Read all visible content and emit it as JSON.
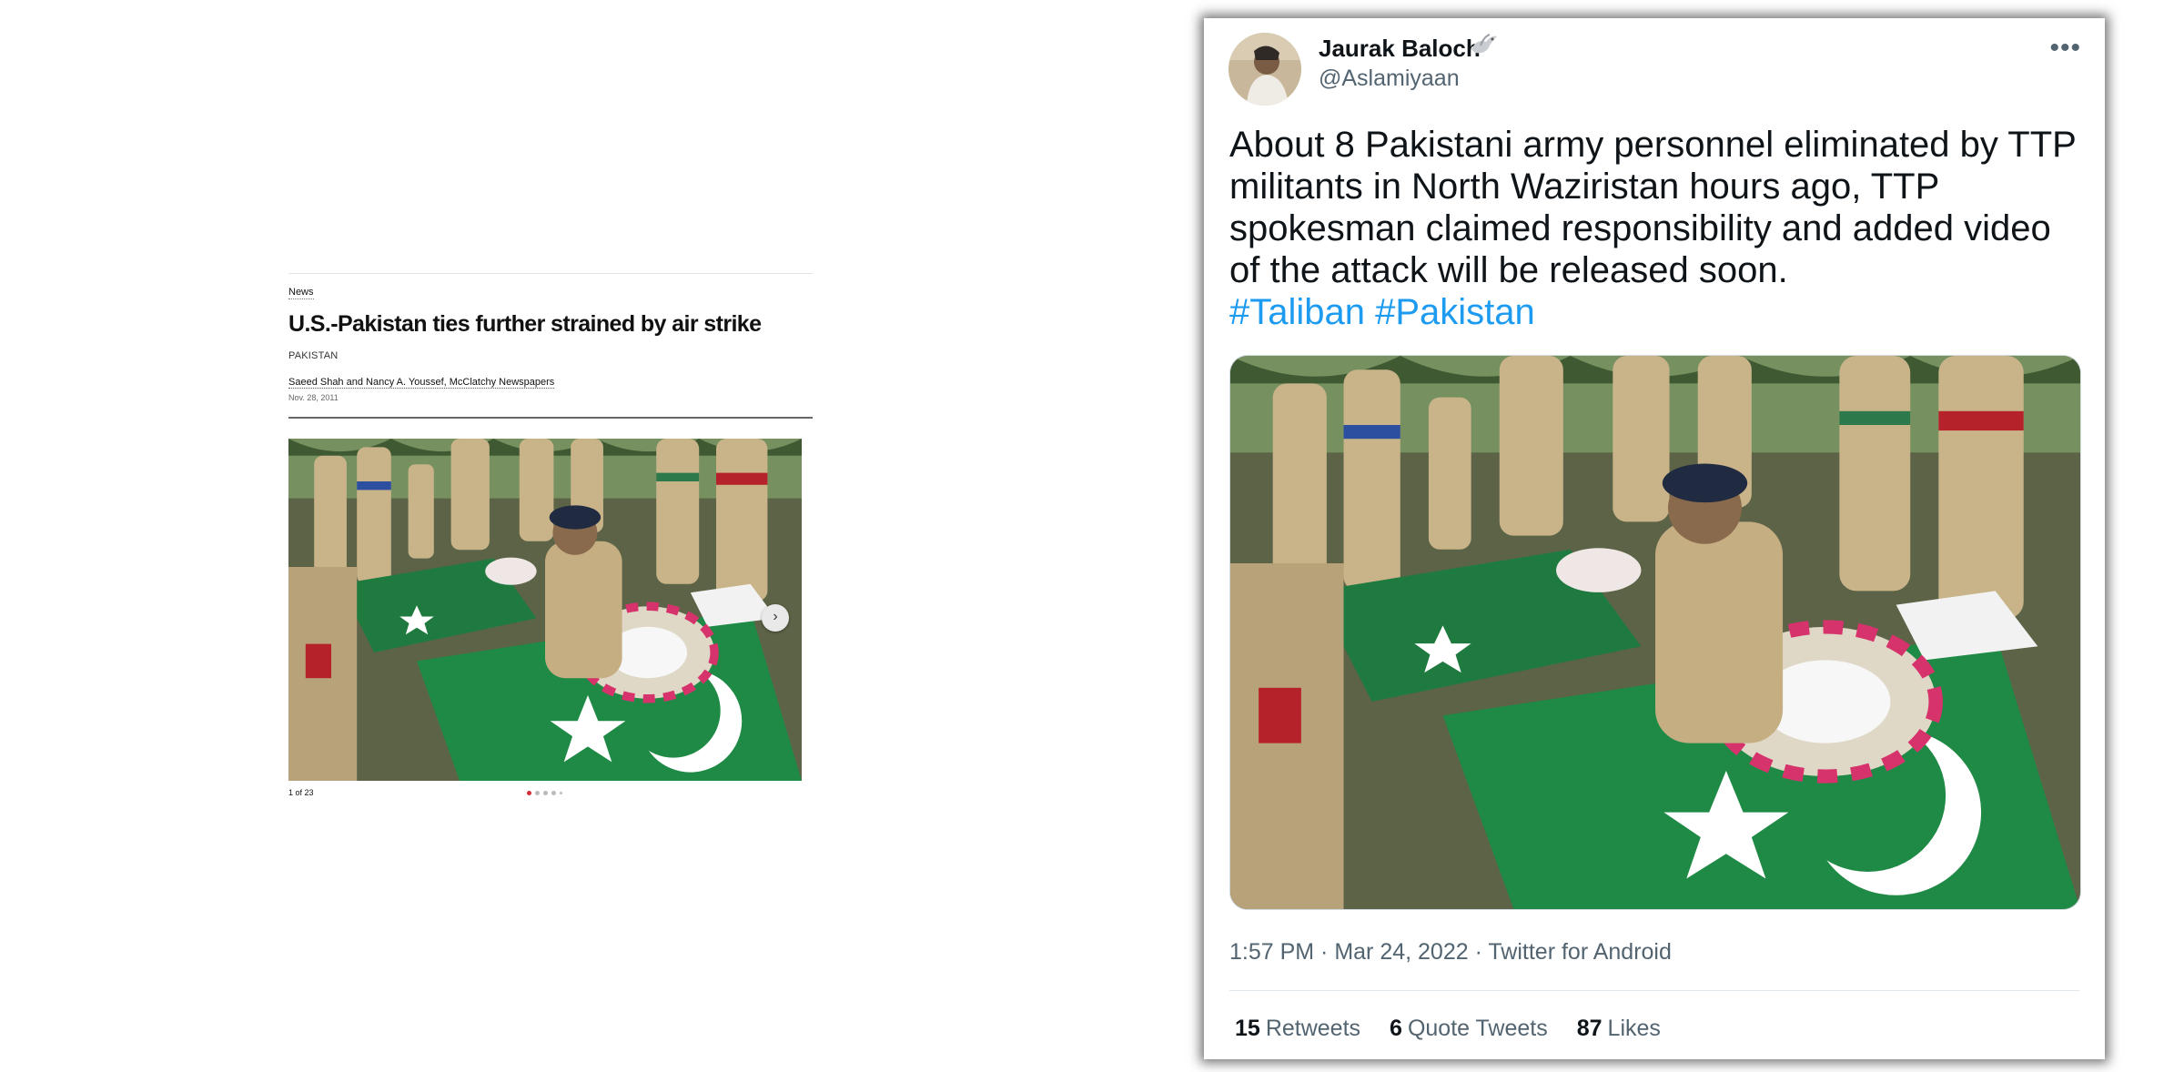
{
  "article": {
    "section": "News",
    "headline": "U.S.-Pakistan ties further strained by air strike",
    "kicker": "PAKISTAN",
    "byline": "Saeed Shah and Nancy A. Youssef, McClatchy Newspapers",
    "date": "Nov. 28, 2011",
    "gallery_counter": "1 of 23",
    "next_icon": "chevron-right-icon",
    "colors": {
      "active_dot": "#d62d3a",
      "rule": "#666666"
    }
  },
  "tweet": {
    "author_name": "Jaurak Baloch",
    "handle": "@Aslamiyaan",
    "text": "About 8 Pakistani army personnel eliminated by TTP militants in North Waziristan hours ago, TTP spokesman claimed responsibility and added video of the attack will be released soon.",
    "hashtags": "#Taliban #Pakistan",
    "timestamp": "1:57 PM · Mar 24, 2022 · Twitter for Android",
    "stats": {
      "retweets_count": "15",
      "retweets_label": "Retweets",
      "quotes_count": "6",
      "quotes_label": "Quote Tweets",
      "likes_count": "87",
      "likes_label": "Likes"
    },
    "more_icon": "more-horizontal-icon",
    "colors": {
      "link": "#1d9bf0",
      "secondary": "#536471",
      "primary": "#0f1419"
    }
  }
}
